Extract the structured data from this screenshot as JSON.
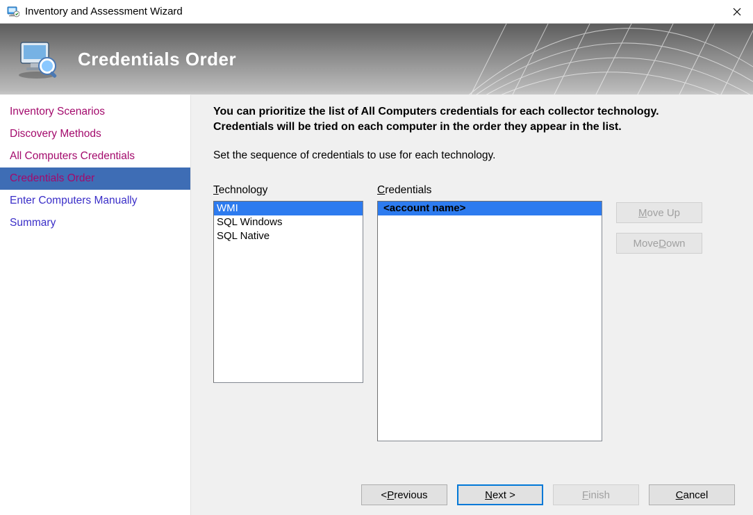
{
  "window": {
    "title": "Inventory and Assessment Wizard"
  },
  "banner": {
    "title": "Credentials Order"
  },
  "sidebar": {
    "items": [
      {
        "label": "Inventory Scenarios",
        "state": "visited"
      },
      {
        "label": "Discovery Methods",
        "state": "visited"
      },
      {
        "label": "All Computers Credentials",
        "state": "visited"
      },
      {
        "label": "Credentials Order",
        "state": "selected"
      },
      {
        "label": "Enter Computers Manually",
        "state": "pending"
      },
      {
        "label": "Summary",
        "state": "pending"
      }
    ]
  },
  "main": {
    "instruction_bold": "You can prioritize the list of All Computers credentials for each collector technology. Credentials will be tried on each computer in the order they appear in the list.",
    "instruction_sub": "Set the sequence of credentials to use for each technology.",
    "technology_label_pre": "T",
    "technology_label_post": "echnology",
    "credentials_label_pre": "C",
    "credentials_label_post": "redentials",
    "technology_items": [
      {
        "label": "WMI",
        "selected": true
      },
      {
        "label": "SQL Windows",
        "selected": false
      },
      {
        "label": "SQL Native",
        "selected": false
      }
    ],
    "credentials_items": [
      {
        "label": "<account name>",
        "selected": true
      }
    ],
    "buttons": {
      "move_up_pre": "M",
      "move_up_post": "ove Up",
      "move_down_pre": "Move ",
      "move_down_post": "Down",
      "move_down_ul": "D"
    }
  },
  "footer": {
    "previous_pre": "< ",
    "previous_ul": "P",
    "previous_post": "revious",
    "next_pre": "",
    "next_ul": "N",
    "next_post": "ext >",
    "finish_pre": "",
    "finish_ul": "F",
    "finish_post": "inish",
    "cancel_pre": "",
    "cancel_ul": "C",
    "cancel_post": "ancel"
  }
}
